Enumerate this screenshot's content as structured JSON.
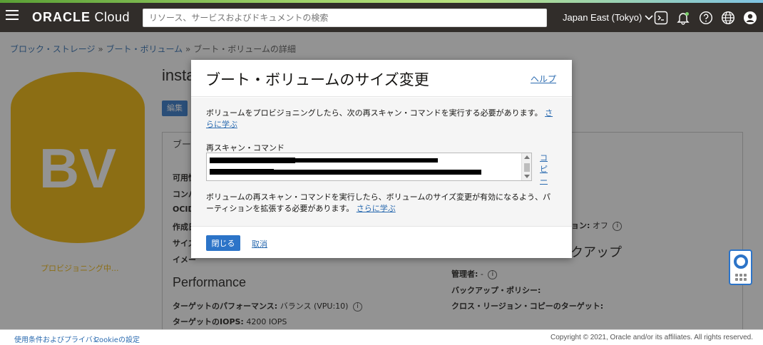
{
  "header": {
    "logo_brand": "ORACLE",
    "logo_product": " Cloud",
    "search_placeholder": "リソース、サービスおよびドキュメントの検索",
    "region": "Japan East (Tokyo)",
    "icons": [
      "menu-icon",
      "cloud-shell-icon",
      "notifications-bell-icon",
      "help-question-icon",
      "language-globe-icon",
      "user-profile-icon"
    ]
  },
  "breadcrumb": {
    "items": [
      "ブロック・ストレージ",
      "ブート・ボリューム",
      "ブート・ボリュームの詳細"
    ],
    "separator": "»"
  },
  "background": {
    "badge_text": "BV",
    "provisioning_status": "プロビジョニング中...",
    "title_fragment": "insta",
    "edit_button": "編集",
    "tab_fragment": "ブー",
    "left_labels": [
      "可用性",
      "コンパ",
      "OCID",
      "作成日",
      "サイズ",
      "イメー"
    ],
    "performance_title": "Performance",
    "target_performance_label": "ターゲットのパフォーマンス:",
    "target_performance_value": "バランス (VPU:10)",
    "target_iops_label": "ターゲットのIOPS:",
    "target_iops_value": "4200 IOPS",
    "right_option_fragment": "ション:",
    "right_option_value": "オフ",
    "backup_title_fragment": "クアップ",
    "manager_label": "管理者:",
    "manager_value": "-",
    "backup_policy_label": "バックアップ・ポリシー:",
    "cross_region_label": "クロス・リージョン・コピーのターゲット:"
  },
  "dialog": {
    "title": "ブート・ボリュームのサイズ変更",
    "help_link": "ヘルプ",
    "paragraph1": "ボリュームをプロビジョニングしたら、次の再スキャン・コマンドを実行する必要があります。",
    "learn_more": "さらに学ぶ",
    "rescan_label": "再スキャン・コマンド",
    "copy_link": "コピー",
    "paragraph2": "ボリュームの再スキャン・コマンドを実行したら、ボリュームのサイズ変更が有効になるよう、パーティションを拡張する必要があります。",
    "close_button": "閉じる",
    "cancel_link": "取消"
  },
  "footer": {
    "terms": "使用条件およびプライバシ",
    "cookies": "Cookieの設定",
    "copyright": "Copyright © 2021, Oracle and/or its affiliates. All rights reserved."
  },
  "colors": {
    "header_bg": "#312d2a",
    "accent_blue": "#2c74c8",
    "link_blue": "#2b6bb0",
    "bv_badge": "#f0b400"
  }
}
